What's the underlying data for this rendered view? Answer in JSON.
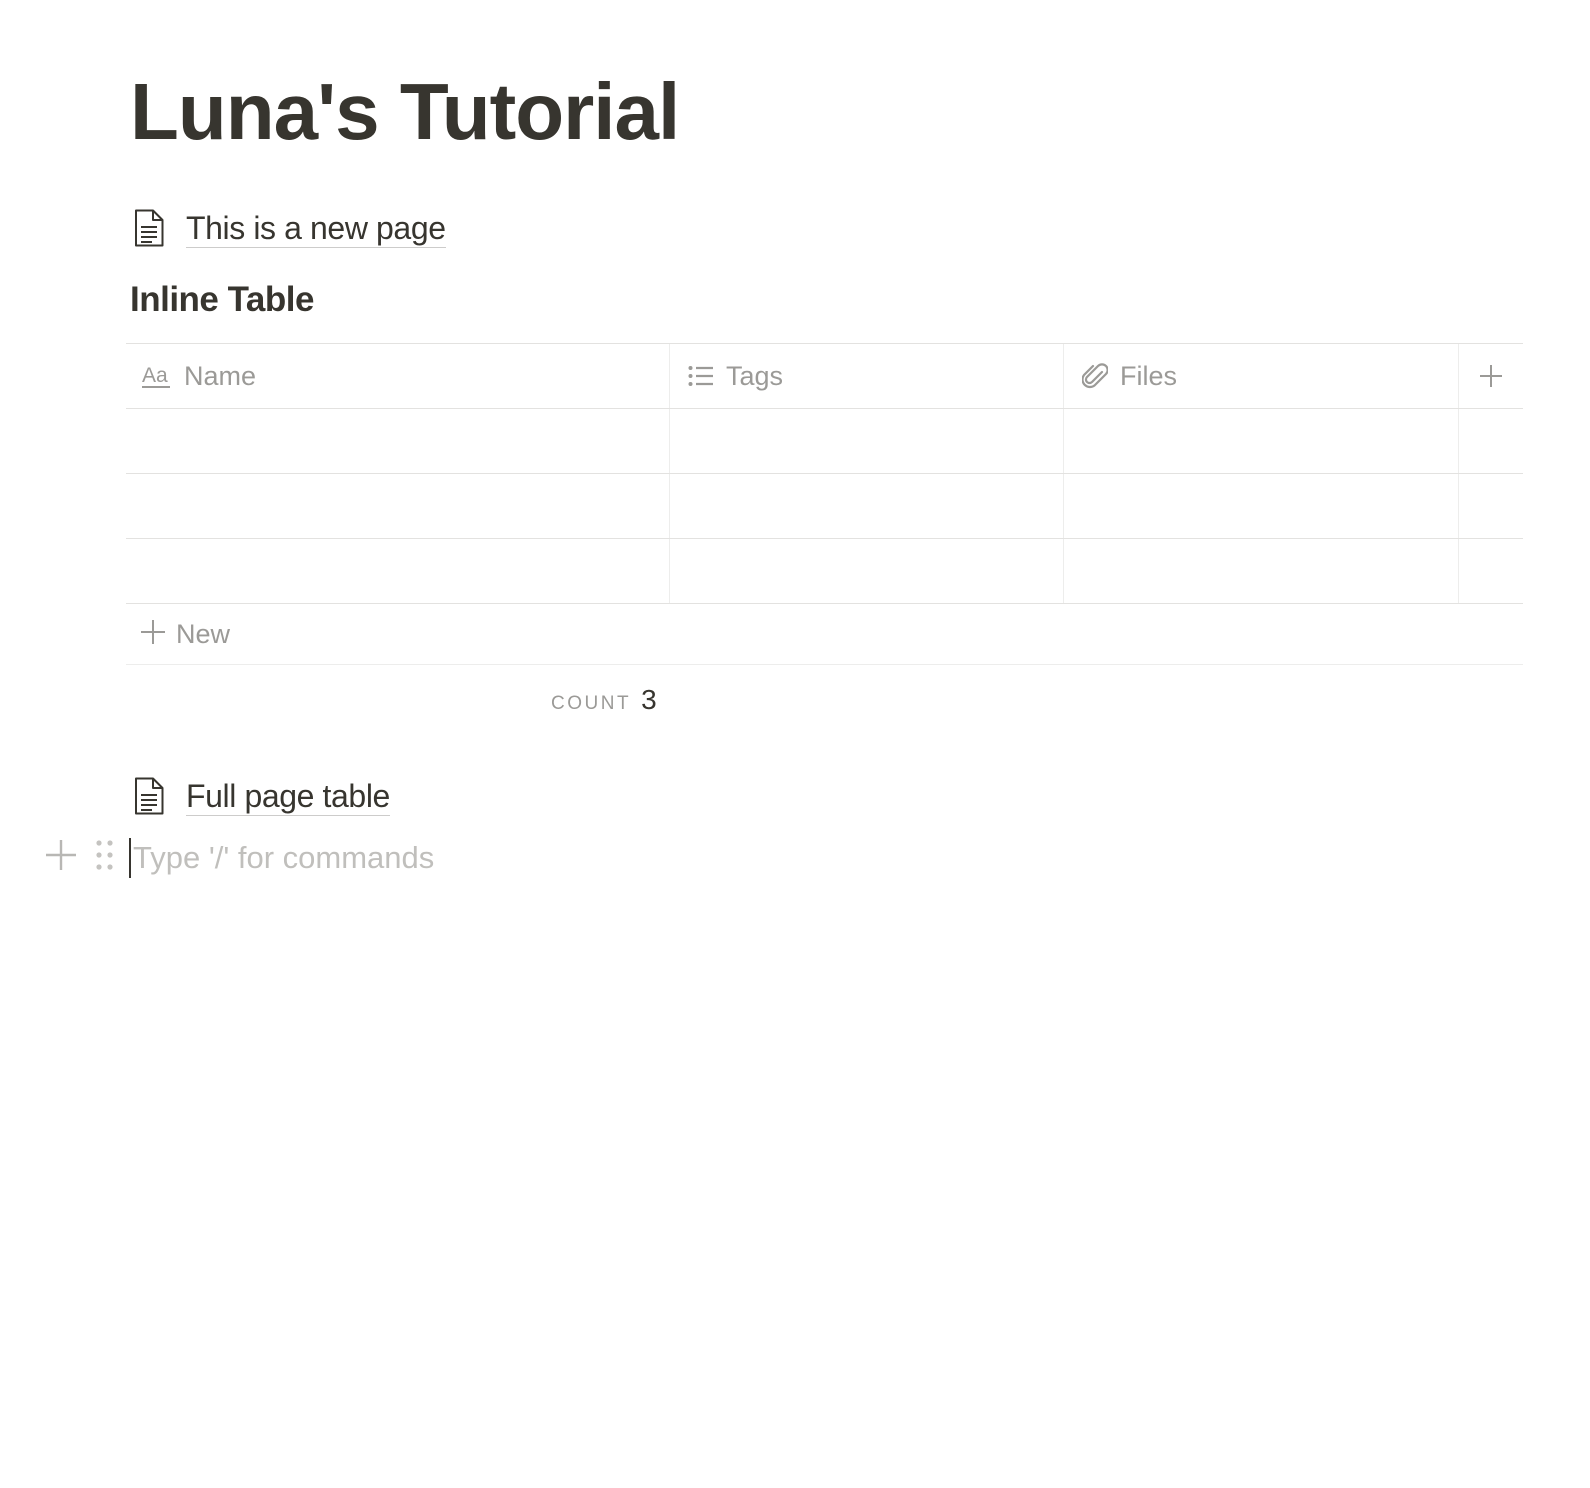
{
  "page": {
    "title": "Luna's Tutorial"
  },
  "blocks": {
    "page_link_1": {
      "label": "This is a new page",
      "icon": "document-icon"
    },
    "table_title": "Inline Table",
    "page_link_2": {
      "label": "Full page table",
      "icon": "document-icon"
    },
    "command_input": {
      "placeholder": "Type '/' for commands",
      "value": ""
    }
  },
  "table": {
    "columns": [
      {
        "label": "Name",
        "icon": "text-property-icon"
      },
      {
        "label": "Tags",
        "icon": "multi-select-icon"
      },
      {
        "label": "Files",
        "icon": "paperclip-icon"
      }
    ],
    "add_column_icon": "plus-icon",
    "rows": [
      {
        "name": "",
        "tags": "",
        "files": ""
      },
      {
        "name": "",
        "tags": "",
        "files": ""
      },
      {
        "name": "",
        "tags": "",
        "files": ""
      }
    ],
    "new_row_label": "New",
    "count_label": "COUNT",
    "count_value": "3"
  },
  "colors": {
    "text": "#37352f",
    "muted": "#9b9a97",
    "border": "#e3e2e0"
  }
}
